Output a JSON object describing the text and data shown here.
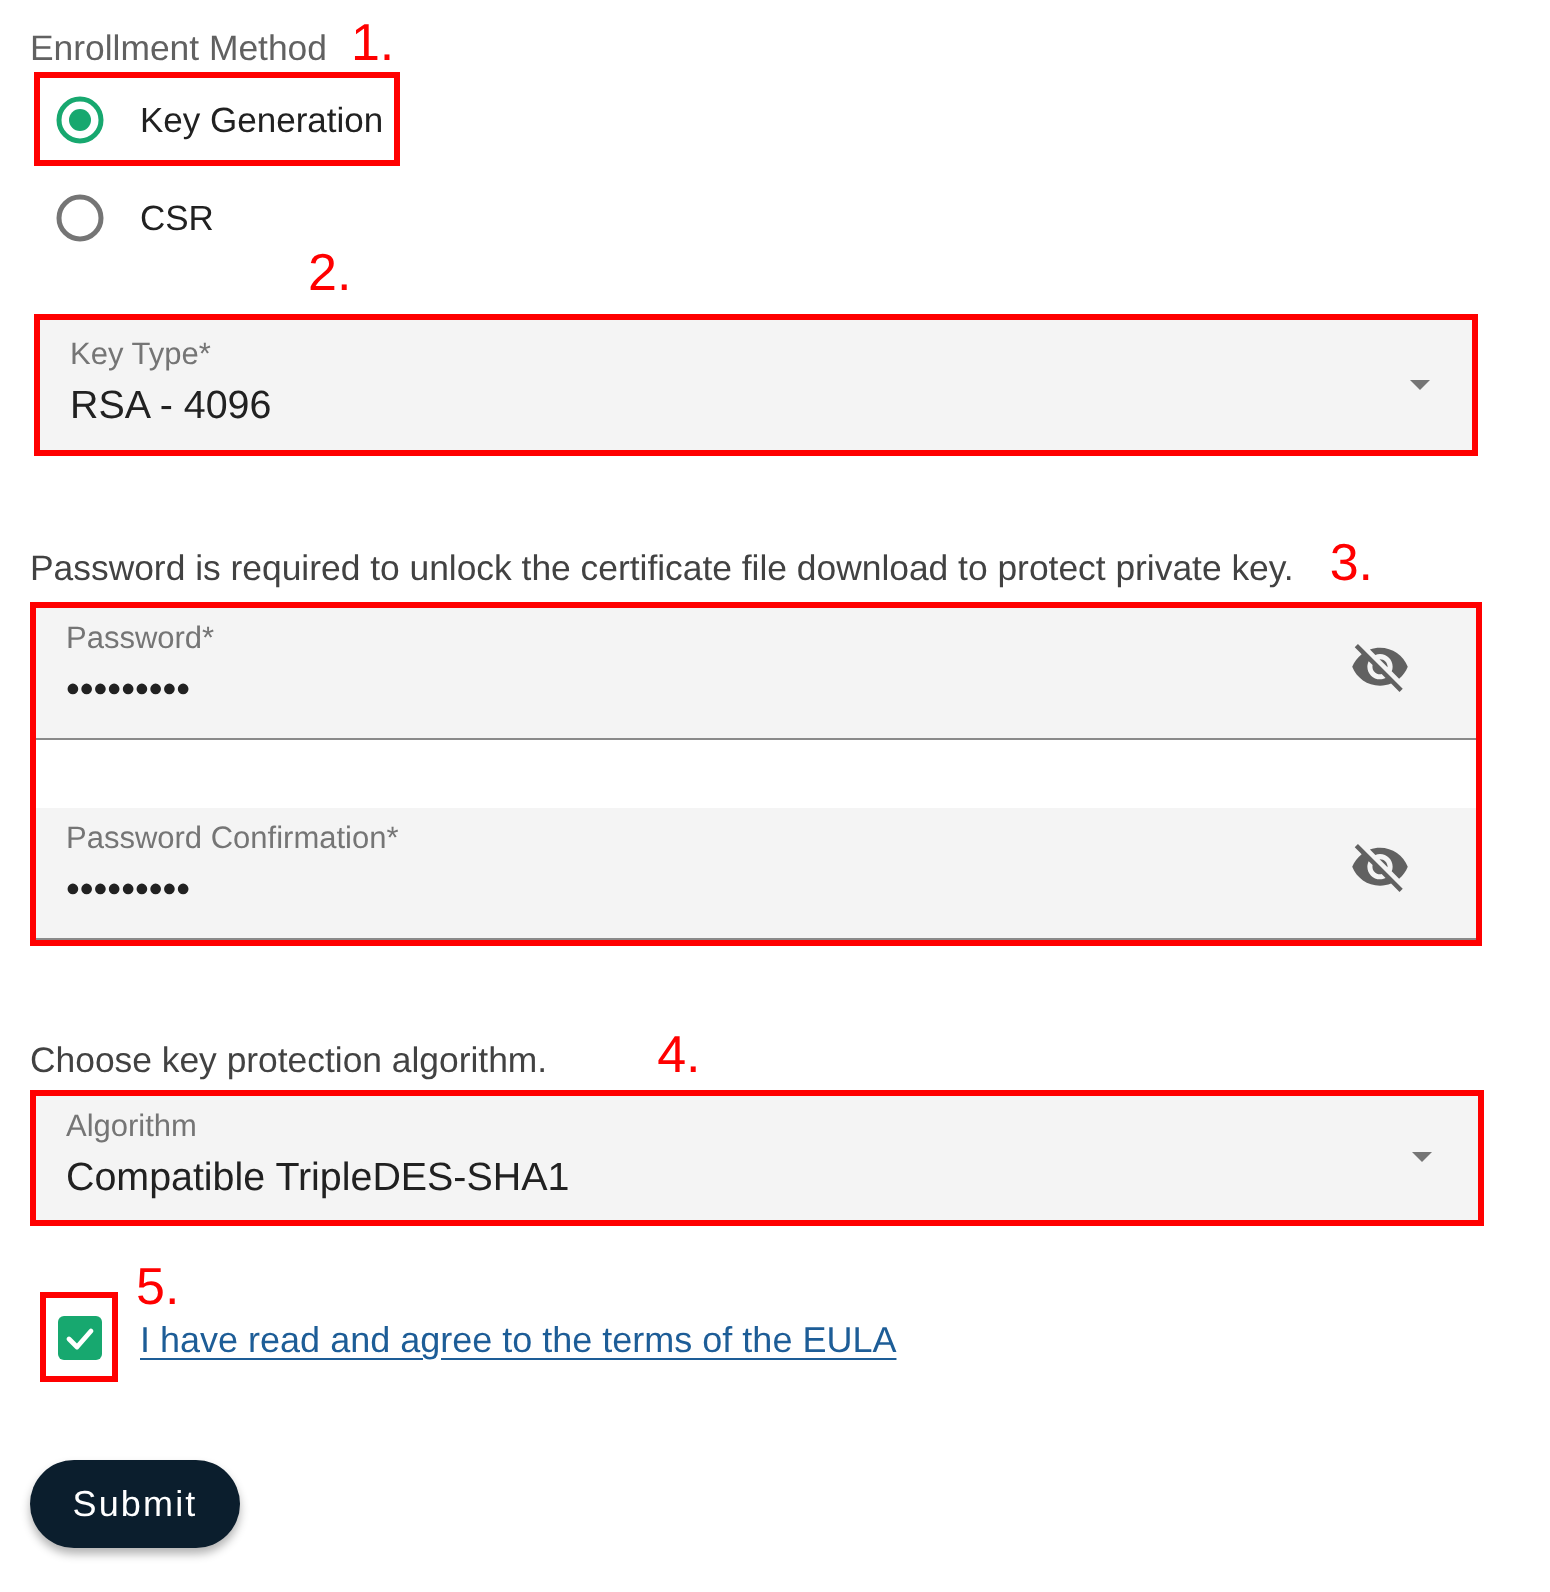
{
  "enrollment_method": {
    "label": "Enrollment Method",
    "annotation": "1.",
    "options": [
      {
        "label": "Key Generation",
        "selected": true,
        "highlighted": true
      },
      {
        "label": "CSR",
        "selected": false,
        "highlighted": false
      }
    ]
  },
  "key_type": {
    "annotation": "2.",
    "label": "Key Type*",
    "value": "RSA - 4096"
  },
  "password_section": {
    "note": "Password is required to unlock the certificate file download to protect private key.",
    "annotation": "3.",
    "fields": [
      {
        "label": "Password*",
        "value": "•••••••••"
      },
      {
        "label": "Password Confirmation*",
        "value": "•••••••••"
      }
    ]
  },
  "algorithm_section": {
    "note": "Choose key protection algorithm.",
    "annotation": "4.",
    "field": {
      "label": "Algorithm",
      "value": "Compatible TripleDES-SHA1"
    }
  },
  "eula": {
    "annotation": "5.",
    "checked": true,
    "link": "I have read and agree to the terms of the EULA"
  },
  "submit_button": {
    "label": "Submit"
  }
}
